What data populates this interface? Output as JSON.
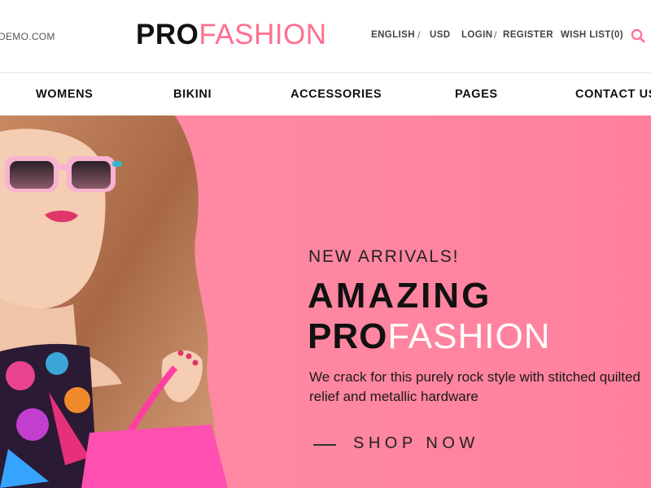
{
  "header": {
    "email_fragment": "DEMO.COM",
    "logo": {
      "bold": "PRO",
      "light": "FASHION"
    },
    "language": "ENGLISH",
    "currency": "USD",
    "login": "LOGIN",
    "register": "REGISTER",
    "wishlist": "WISH LIST(0)",
    "separator": "/",
    "search_icon": "search-icon"
  },
  "nav": {
    "items": [
      "WOMENS",
      "BIKINI",
      "ACCESSORIES",
      "PAGES",
      "CONTACT US"
    ]
  },
  "hero": {
    "subtitle": "NEW ARRIVALS!",
    "title_line1": "AMAZING",
    "title_line2_bold": "PRO",
    "title_line2_light": "FASHION",
    "description": "We crack for this purely rock style with stitched quilted relief and metallic hardware",
    "cta": "SHOP NOW",
    "image": "model-with-pink-sunglasses"
  },
  "colors": {
    "accent": "#ff6f91",
    "hero_background": "#ff86a2",
    "text_dark": "#111111"
  }
}
